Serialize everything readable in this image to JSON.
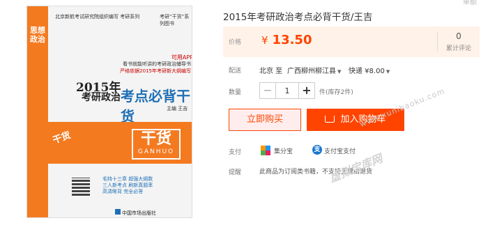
{
  "top_corner_text": "单额",
  "book_cover": {
    "series": "北京新航考试研究院组织编写 考研系列",
    "series_right": "考研“干货”系列图书",
    "spine_text": "思想政治",
    "app_note": "可用APP",
    "sub1": "看书就能听讲的考研政治辅导书",
    "sub2": "严格依据2015年考研新大纲编写",
    "year": "2015年",
    "kaoyan": "考研政治",
    "main_title": "考点必背干货",
    "author": "主编 王吉",
    "ganhuo_cn": "干货",
    "ganhuo_en": "GANHUO",
    "badge": "干货",
    "features": "毛特十三章 超强大纲数 三人新考点 刷新真题率 高清晰背 完全必答",
    "publisher": "中国市场出版社"
  },
  "product": {
    "title": "2015年考研政治考点必背干货/王吉",
    "price_label": "价格",
    "currency": "¥",
    "price": "13.50",
    "review_count": "0",
    "review_label": "累计评论",
    "shipping_label": "配送",
    "ship_from": "北京 至",
    "ship_to": "广西柳州柳江县",
    "express": "快递 ¥8.00",
    "qty_label": "数量",
    "qty_minus": "−",
    "qty_value": "1",
    "qty_plus": "+",
    "stock": "件(库存2件)",
    "buy_now": "立即购买",
    "add_cart": "加入购物车",
    "pay_label": "支付",
    "pay1": "集分宝",
    "pay2": "支付宝支付",
    "tip_label": "提醒",
    "tip_text": "此商品为订阅类书籍，不支持无理由退货"
  },
  "watermark": {
    "url": "www.xunibaoku.com",
    "cn": "虚拟宝库网"
  },
  "colors": {
    "accent": "#ff4400",
    "price_bg": "#fff2e8",
    "cover_orange": "#f47a20",
    "cover_blue": "#1f6fb5"
  }
}
